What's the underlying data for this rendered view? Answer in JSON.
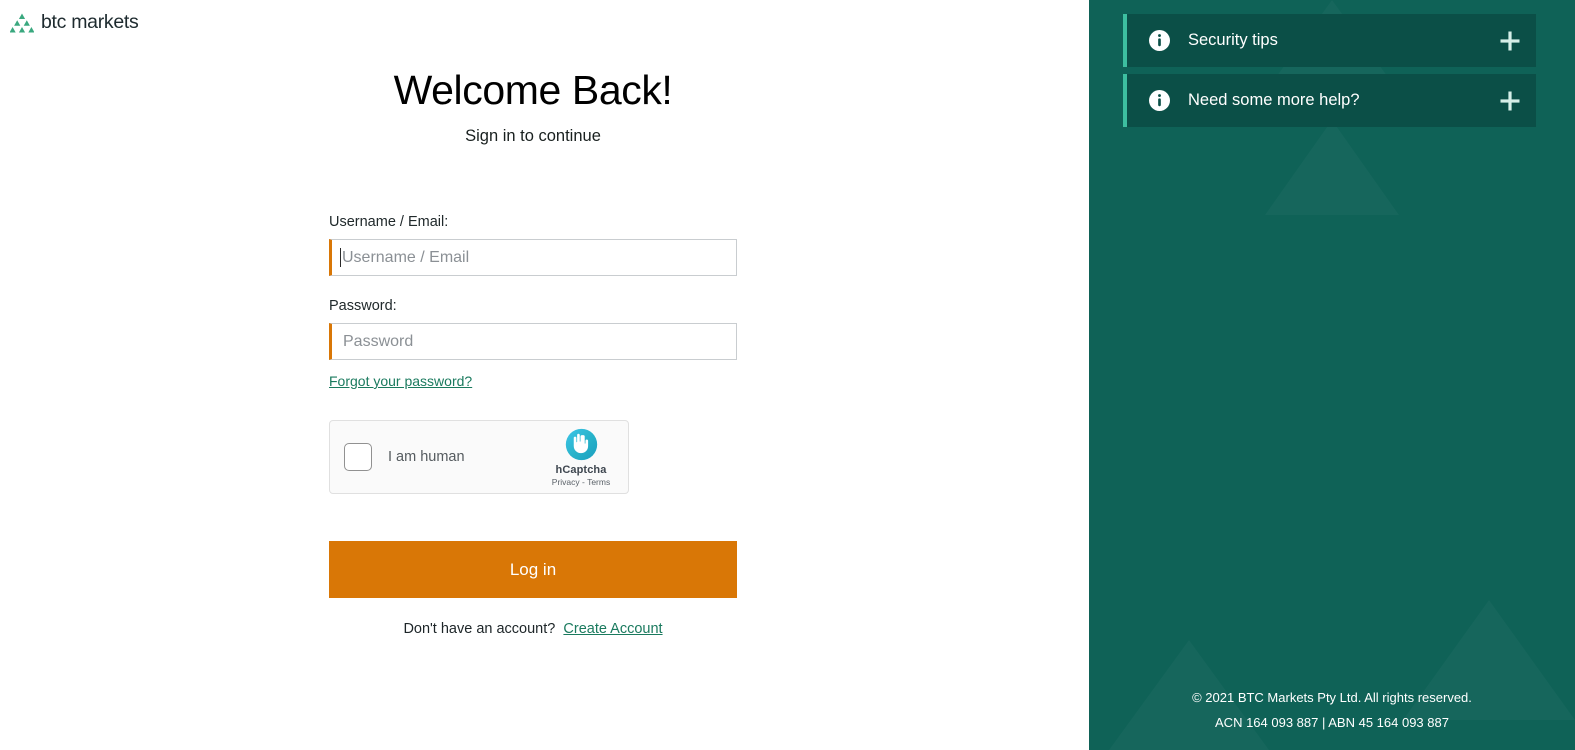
{
  "brand": {
    "name": "btc markets",
    "logo_icon": "triangles-pyramid-icon",
    "logo_color": "#3aa87f"
  },
  "main": {
    "title": "Welcome Back!",
    "subtitle": "Sign in to continue",
    "username": {
      "label": "Username / Email:",
      "placeholder": "Username / Email",
      "value": "",
      "focused": true
    },
    "password": {
      "label": "Password:",
      "placeholder": "Password",
      "value": ""
    },
    "forgot_password_link": "Forgot your password?",
    "captcha": {
      "checkbox_label": "I am human",
      "brand_name": "hCaptcha",
      "terms_text": "Privacy - Terms",
      "logo_icon": "hcaptcha-hand-icon",
      "checked": false
    },
    "login_button": "Log in",
    "signup_prompt": "Don't have an account?",
    "signup_link": "Create Account"
  },
  "sidebar": {
    "accordions": [
      {
        "label": "Security tips",
        "icon": "info-icon",
        "expand_icon": "plus-icon"
      },
      {
        "label": "Need some more help?",
        "icon": "info-icon",
        "expand_icon": "plus-icon"
      }
    ],
    "footer": {
      "copyright": "© 2021 BTC Markets Pty Ltd. All rights reserved.",
      "registration": "ACN 164 093 887 | ABN 45 164 093 887"
    }
  },
  "colors": {
    "accent_orange": "#d97706",
    "panel_teal": "#0f6257",
    "panel_dark_teal": "#0b4f47",
    "accent_mint": "#3dbfa0",
    "link_green": "#1a7a5e"
  }
}
